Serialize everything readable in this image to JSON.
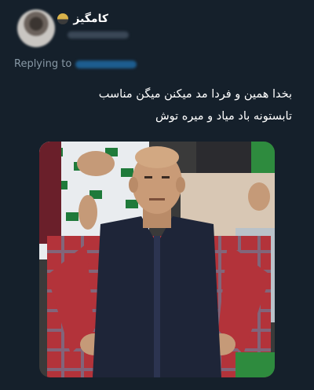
{
  "header": {
    "display_name": "کامگیز",
    "emoji": "owl-emoji"
  },
  "reply": {
    "prefix": "Replying to"
  },
  "tweet": {
    "line1": "بخدا همین و فردا مد میکنن میگن مناسب",
    "line2": "تابستونه باد میاد و میره توش"
  },
  "colors": {
    "background": "#15202b",
    "text": "#ffffff",
    "muted": "#8899a6",
    "link": "#1d9bf0"
  }
}
